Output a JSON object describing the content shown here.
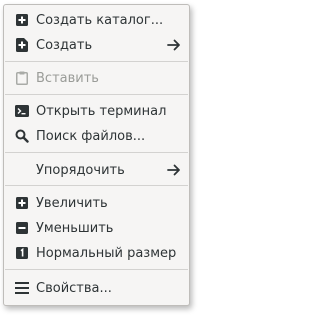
{
  "menu": {
    "create_folder": {
      "label": "Создать каталог...",
      "icon": "add-folder-icon"
    },
    "create": {
      "label": "Создать",
      "icon": "add-icon",
      "submenu_icon": "arrow-right-icon"
    },
    "paste": {
      "label": "Вставить",
      "icon": "clipboard-icon",
      "disabled": true
    },
    "open_terminal": {
      "label": "Открыть терминал",
      "icon": "terminal-icon"
    },
    "search_files": {
      "label": "Поиск файлов...",
      "icon": "search-icon"
    },
    "arrange": {
      "label": "Упорядочить",
      "submenu_icon": "arrow-right-icon"
    },
    "zoom_in": {
      "label": "Увеличить",
      "icon": "plus-icon"
    },
    "zoom_out": {
      "label": "Уменьшить",
      "icon": "minus-icon"
    },
    "normal_size": {
      "label": "Нормальный размер",
      "icon": "one-icon"
    },
    "properties": {
      "label": "Свойства...",
      "icon": "menu-lines-icon"
    }
  }
}
